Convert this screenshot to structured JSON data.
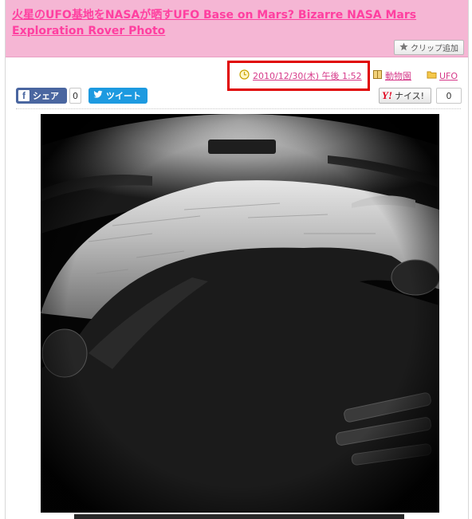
{
  "post": {
    "title": "火星のUFO基地をNASAが晒すUFO Base on Mars? Bizarre NASA Mars Exploration Rover Photo",
    "clip_label": "クリップ追加",
    "date": "2010/12/30(木) 午後 1:52",
    "categories": [
      "動物園",
      "UFO"
    ]
  },
  "share": {
    "facebook_label": "シェア",
    "facebook_count": "0",
    "twitter_label": "ツイート",
    "yahoo_label": "ナイス!",
    "yahoo_count": "0"
  },
  "icons": {
    "clip": "star-icon",
    "date": "clock-icon",
    "category1": "book-icon",
    "category2": "folder-icon"
  },
  "colors": {
    "title_bg": "#f5b6d4",
    "title_text": "#ff3fa0",
    "link": "#d63a8a",
    "highlight": "#e00000",
    "facebook": "#4a66a0",
    "twitter": "#1d9ae0"
  }
}
